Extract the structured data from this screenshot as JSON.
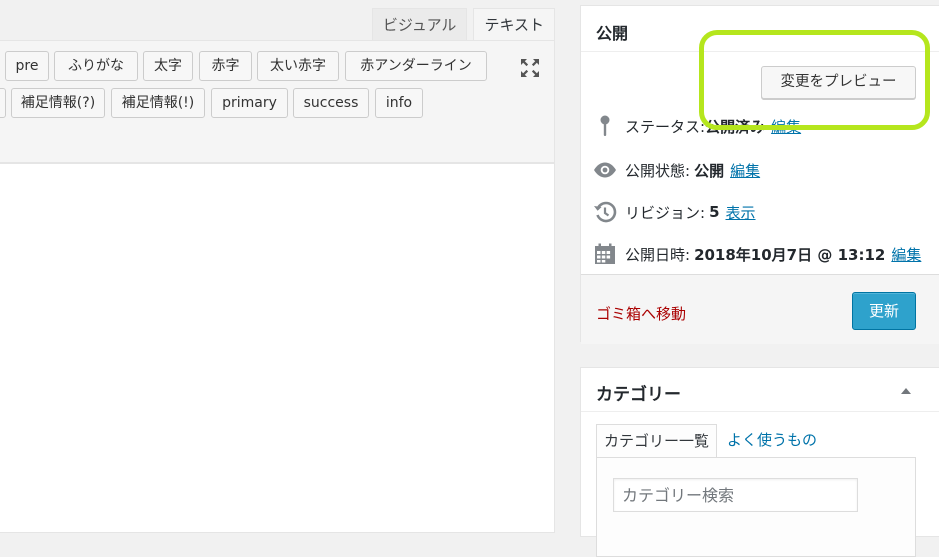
{
  "editor": {
    "tabs": {
      "visual": "ビジュアル",
      "text": "テキスト"
    },
    "quicktags": [
      "pre",
      "ふりがな",
      "太字",
      "赤字",
      "太い赤字",
      "赤アンダーライン",
      "補足情報(?)",
      "補足情報(!)",
      "primary",
      "success",
      "info"
    ],
    "icons": {
      "expand": "fullscreen-expand-icon"
    }
  },
  "publish": {
    "title": "公開",
    "preview_label": "変更をプレビュー",
    "status": {
      "label": "ステータス:",
      "value": "公開済み",
      "edit": "編集"
    },
    "visibility": {
      "label": "公開状態:",
      "value": "公開",
      "edit": "編集"
    },
    "revisions": {
      "label": "リビジョン:",
      "value": "5",
      "link": "表示"
    },
    "date": {
      "label": "公開日時:",
      "value": "2018年10月7日 @ 13:12",
      "edit": "編集"
    },
    "trash_label": "ゴミ箱へ移動",
    "update_label": "更新",
    "highlight_color": "#b5e61d"
  },
  "category": {
    "title": "カテゴリー",
    "tabs": {
      "all": "カテゴリー一覧",
      "popular": "よく使うもの"
    },
    "search_placeholder": "カテゴリー検索"
  },
  "colors": {
    "link": "#0073aa",
    "primary_button": "#2ea2cc",
    "trash": "#aa0000"
  }
}
